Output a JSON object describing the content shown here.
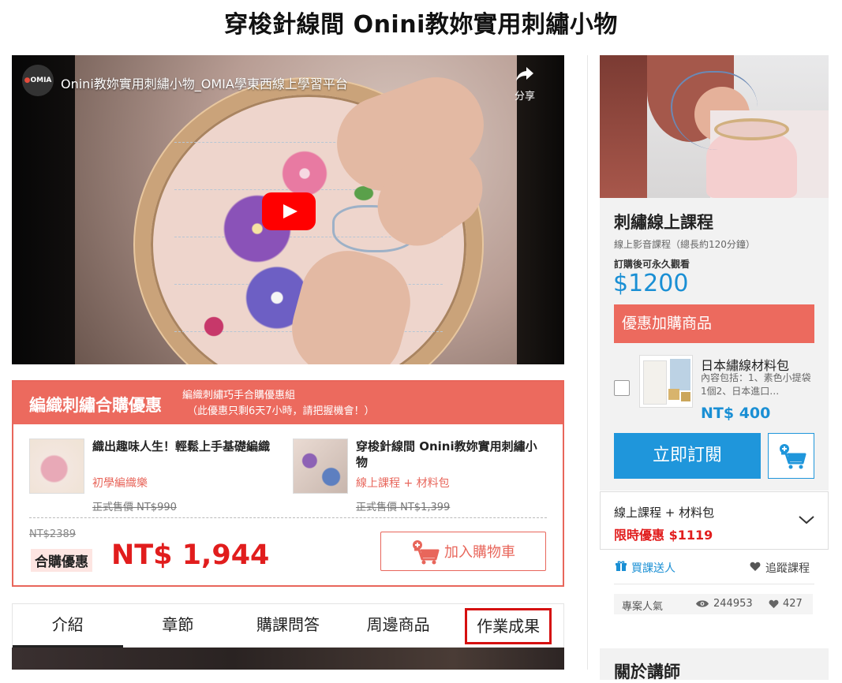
{
  "page": {
    "title": "穿梭針線間 Onini教妳實用刺繡小物"
  },
  "video": {
    "channel_logo": "OMIA",
    "title": "Onini教妳實用刺繡小物_OMIA學東西線上學習平台",
    "share_label": "分享",
    "icons": {
      "share": "share-arrow-icon",
      "play": "youtube-play-icon"
    }
  },
  "bundle": {
    "title": "編織刺繡合購優惠",
    "subtitle_line1": "編織刺繡巧手合購優惠組",
    "subtitle_line2": "（此優惠只剩6天7小時，請把握機會！）",
    "items": [
      {
        "name": "織出趣味人生！輕鬆上手基礎編織",
        "tag": "初學編織樂",
        "original_price": "正式售價 NT$990"
      },
      {
        "name": "穿梭針線間 Onini教妳實用刺繡小物",
        "tag": "線上課程 + 材料包",
        "original_price": "正式售價 NT$1,399"
      }
    ],
    "old_total": "NT$2389",
    "deal_label": "合購優惠",
    "deal_price": "NT$ 1,944",
    "add_to_cart": "加入購物車"
  },
  "tabs": [
    {
      "label": "介紹",
      "active": true
    },
    {
      "label": "章節",
      "active": false
    },
    {
      "label": "購課問答",
      "active": false
    },
    {
      "label": "周邊商品",
      "active": false
    },
    {
      "label": "作業成果",
      "active": false,
      "highlighted": true
    }
  ],
  "sidebar": {
    "course_title": "刺繡線上課程",
    "course_meta": "線上影音課程（總長約120分鐘）",
    "course_note": "訂購後可永久觀看",
    "price": "$1200",
    "upsell_header": "優惠加購商品",
    "addon": {
      "name": "日本繡線材料包",
      "description": "內容包括：1、素色小提袋1個2、日本進口…",
      "price": "NT$ 400"
    },
    "subscribe_label": "立即訂閱",
    "option": {
      "name": "線上課程 + 材料包",
      "price": "限時優惠 $1119"
    },
    "gift_label": "買課送人",
    "follow_label": "追蹤課程",
    "stats": {
      "label": "專案人氣",
      "views": "244953",
      "likes": "427"
    },
    "about_title": "關於講師"
  },
  "colors": {
    "accent_red": "#ec6a5e",
    "price_red": "#e11d1d",
    "brand_blue": "#1f96db",
    "youtube_red": "#ff0000"
  }
}
